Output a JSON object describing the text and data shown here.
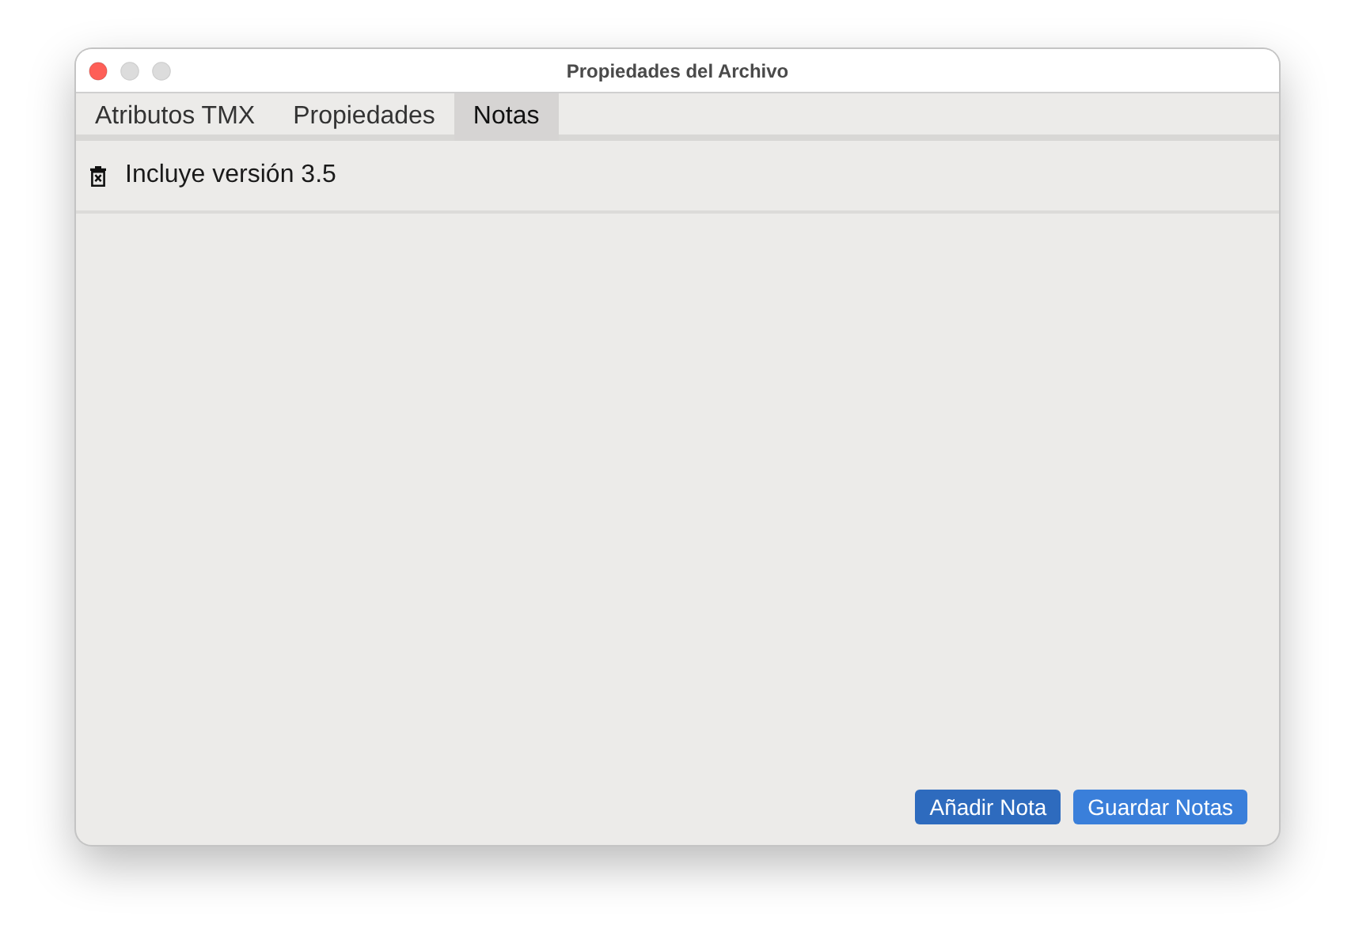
{
  "window": {
    "title": "Propiedades del Archivo",
    "controls": [
      {
        "kind": "close",
        "disabled": false
      },
      {
        "kind": "minimize",
        "disabled": true
      },
      {
        "kind": "zoom",
        "disabled": true
      }
    ]
  },
  "tabs": [
    {
      "label": "Atributos TMX",
      "selected": false
    },
    {
      "label": "Propiedades",
      "selected": false
    },
    {
      "label": "Notas",
      "selected": true
    }
  ],
  "notes": [
    {
      "text": "Incluye versión 3.5"
    }
  ],
  "buttons": [
    {
      "label": "Añadir Nota",
      "focused": true
    },
    {
      "label": "Guardar Notas",
      "focused": false
    }
  ]
}
